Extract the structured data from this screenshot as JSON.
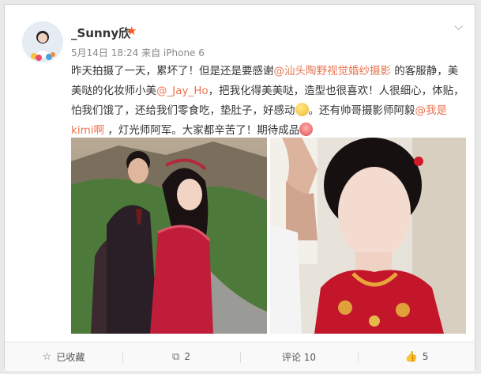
{
  "post": {
    "username": "_Sunny欣",
    "verified_icon": "star-icon",
    "meta": "5月14日 18:24 来自 iPhone 6",
    "text": {
      "p1": "昨天拍摄了一天，累坏了！但是还是要感谢",
      "m1": "@汕头陶野视觉婚纱摄影",
      "p2": "的客服静，美美哒的化妆师小美",
      "m2": "@_Jay_Ho",
      "p3": "，把我化得美美哒，造型也很喜欢！人很细心，体贴，怕我们饿了，还给我们零食吃，垫肚子，好感动",
      "p4": "。还有帅哥摄影师阿毅",
      "m3": "@我是kimi啊",
      "p5": "，灯光师阿军。大家都辛苦了！期待成品"
    }
  },
  "actions": {
    "favorite": "已收藏",
    "repost": "2",
    "comment": "评论 10",
    "like": "5"
  },
  "colors": {
    "mention": "#eb7350",
    "badge": "#f55a1c"
  }
}
